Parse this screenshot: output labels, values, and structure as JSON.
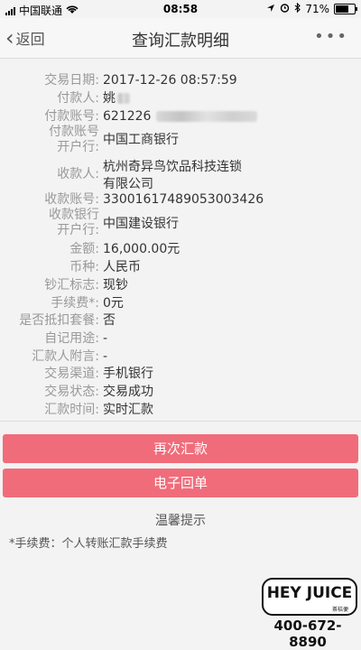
{
  "status_bar": {
    "carrier": "中国联通",
    "time": "08:58",
    "battery": "71%",
    "battery_level": 0.71
  },
  "nav": {
    "back_label": "返回",
    "title": "查询汇款明细",
    "more_label": "•••"
  },
  "details": [
    {
      "label": "交易日期:",
      "value": "2017-12-26 08:57:59"
    },
    {
      "label": "付款人:",
      "value": "姚"
    },
    {
      "label": "付款账号:",
      "value": "621226"
    },
    {
      "label": "付款账号\n开户行:",
      "value": "中国工商银行"
    },
    {
      "label": "收款人:",
      "value": "杭州奇异鸟饮品科技连锁\n有限公司"
    },
    {
      "label": "收款账号:",
      "value": "33001617489053003426"
    },
    {
      "label": "收款银行\n开户行:",
      "value": "中国建设银行"
    },
    {
      "label": "金额:",
      "value": "16,000.00元"
    },
    {
      "label": "币种:",
      "value": "人民币"
    },
    {
      "label": "钞汇标志:",
      "value": "现钞"
    },
    {
      "label": "手续费*:",
      "value": "0元"
    },
    {
      "label": "是否抵扣套餐:",
      "value": "否"
    },
    {
      "label": "自记用途:",
      "value": "-"
    },
    {
      "label": "汇款人附言:",
      "value": "-"
    },
    {
      "label": "交易渠道:",
      "value": "手机银行"
    },
    {
      "label": "交易状态:",
      "value": "交易成功"
    },
    {
      "label": "汇款时间:",
      "value": "实时汇款"
    }
  ],
  "buttons": {
    "remit_again": "再次汇款",
    "e_receipt": "电子回单"
  },
  "tips": {
    "title": "温馨提示",
    "line": "*手续费：个人转账汇款手续费"
  },
  "watermark": {
    "logo_text": "HEY JUICE",
    "logo_sub": "茶桔便",
    "phone": "400-672-8890"
  }
}
